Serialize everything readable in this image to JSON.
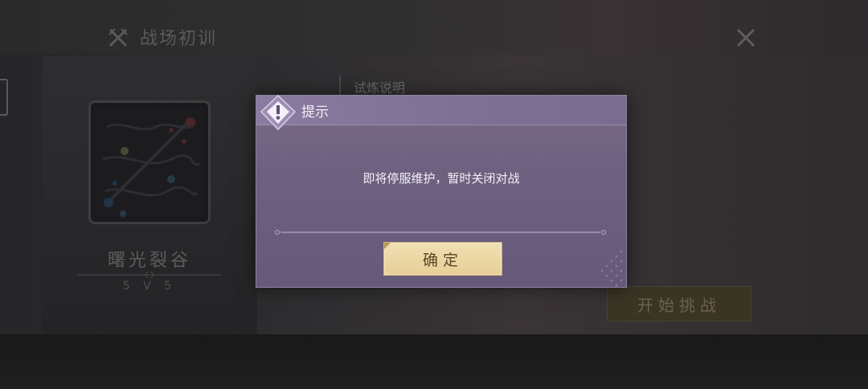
{
  "header": {
    "title": "战场初训",
    "icon": "crossed-swords-icon",
    "close_icon": "close-icon"
  },
  "map": {
    "name": "曙光裂谷",
    "mode": "5 V 5"
  },
  "description_label": "试炼说明",
  "start_button": "开始挑战",
  "dialog": {
    "title": "提示",
    "message": "即将停服维护，暂时关闭对战",
    "confirm_button": "确定",
    "badge_icon": "exclamation-icon"
  },
  "colors": {
    "dialog_bg": "#6e6180",
    "confirm_button_bg": "#ecd6a5",
    "start_button_bg": "#3a3424"
  }
}
